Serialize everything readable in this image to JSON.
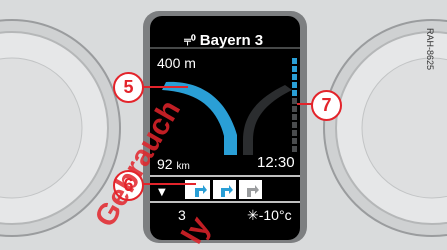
{
  "colors": {
    "background": "#d9dbdc",
    "display": "#000000",
    "route": "#2a9fd6",
    "callout": "#e3242b",
    "watermark": "#e3242b"
  },
  "display": {
    "station_icon": "radio-icon",
    "station": "Bayern 3",
    "distance": "400 m",
    "remaining_value": "92",
    "remaining_unit": "km",
    "time": "12:30",
    "track": "3",
    "temperature": "✳-10°c",
    "menu_arrow": "▼",
    "lane_icons": [
      "lane-turn-right-icon",
      "lane-turn-right-icon",
      "lane-straight-right-icon"
    ]
  },
  "callouts": {
    "c5": "5",
    "c6": "6",
    "c7": "7"
  },
  "watermark": {
    "text1": "Gebrauch",
    "text2": "ly"
  },
  "image_code": "RAH-8625"
}
